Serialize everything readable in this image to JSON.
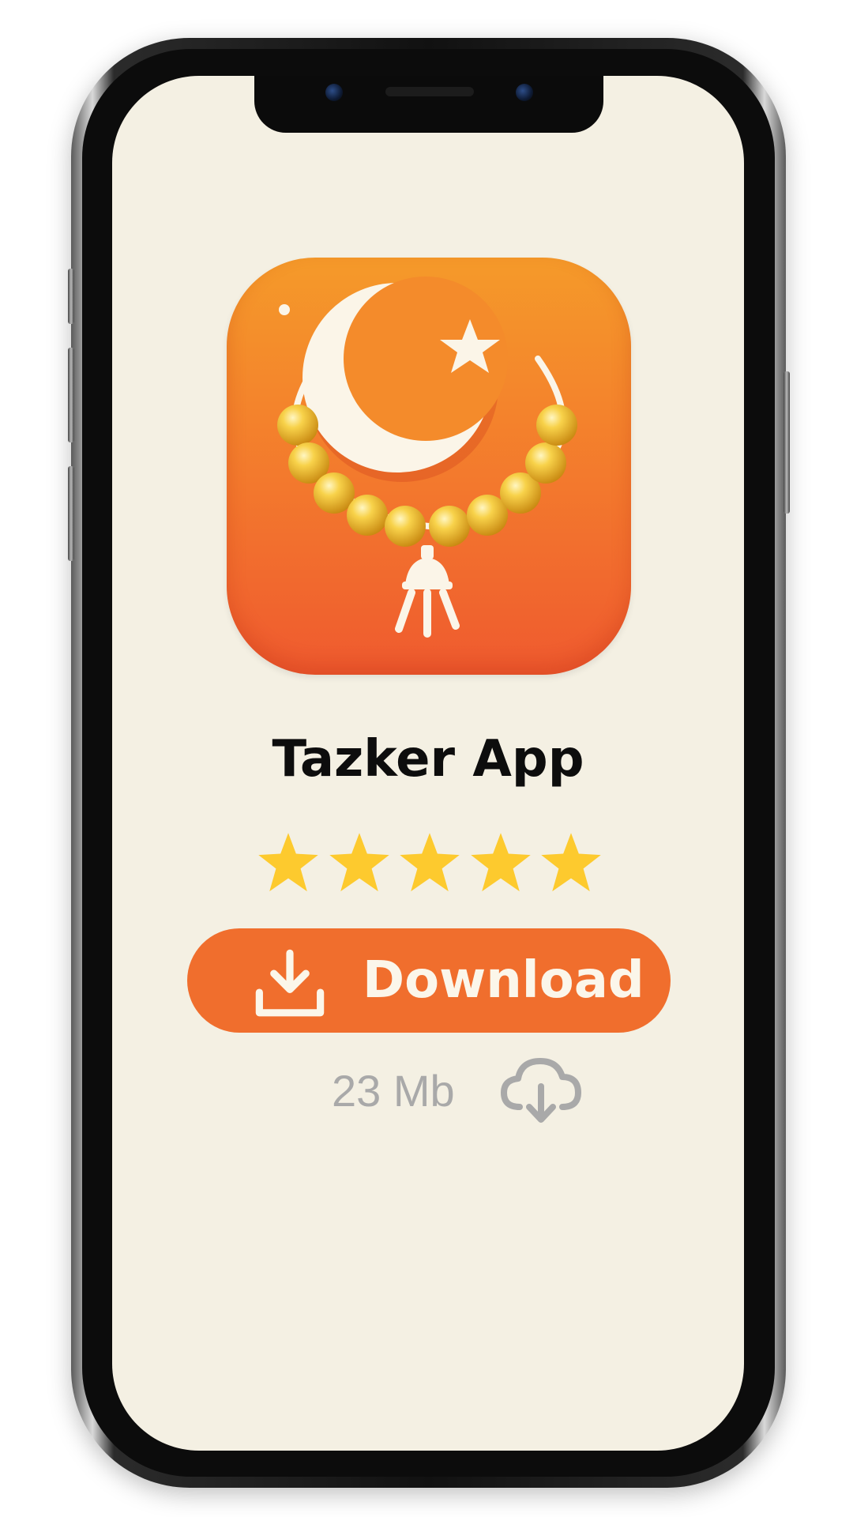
{
  "app": {
    "name": "Tazker App",
    "rating": 5,
    "rating_max": 5
  },
  "download": {
    "label": "Download",
    "size": "23 Mb"
  },
  "icons": {
    "app_icon": "crescent-star-prayer-beads-icon",
    "download": "download-icon",
    "cloud_download": "cloud-download-icon",
    "star": "star-icon"
  },
  "colors": {
    "screen_bg": "#f4f0e3",
    "accent": "#f06e2d",
    "star": "#fdca2e",
    "muted": "#a9a9a9"
  }
}
